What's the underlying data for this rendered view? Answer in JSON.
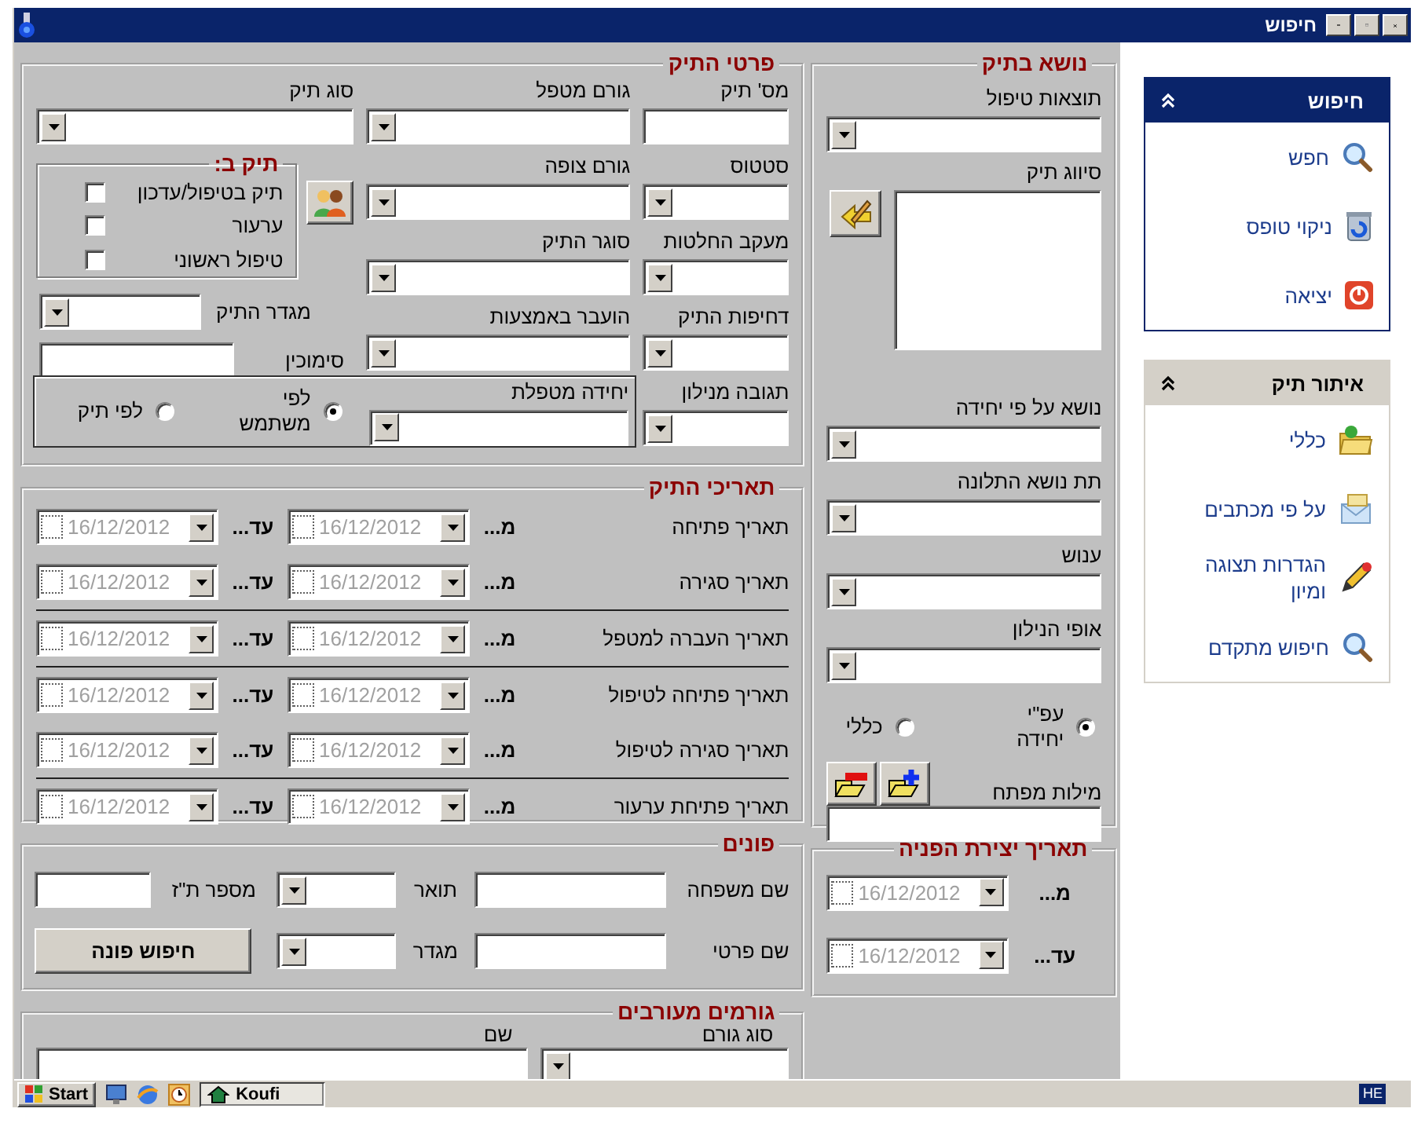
{
  "window": {
    "title": "חיפוש"
  },
  "case_details": {
    "title": "פרטי התיק",
    "fields": [
      {
        "label": "מס' תיק",
        "kind": "text"
      },
      {
        "label": "גורם מטפל",
        "kind": "combo"
      },
      {
        "label": "סוג תיק",
        "kind": "combo"
      },
      {
        "label": "סטטוס",
        "kind": "combo"
      },
      {
        "label": "גורם צופה",
        "kind": "combo"
      },
      {
        "label": "מעקב החלטות",
        "kind": "combo"
      },
      {
        "label": "סוגר התיק",
        "kind": "combo"
      },
      {
        "label": "דחיפות התיק",
        "kind": "combo"
      },
      {
        "label": "הועבר באמצעות",
        "kind": "combo"
      },
      {
        "label": "תגובה מנילון",
        "kind": "combo"
      },
      {
        "label": "מגדר התיק",
        "kind": "combo"
      },
      {
        "label": "סימוכין",
        "kind": "text"
      }
    ],
    "case_in": {
      "title": "תיק ב:",
      "options": [
        {
          "label": "תיק בטיפול/עדכון",
          "checked": false
        },
        {
          "label": "ערעור",
          "checked": false
        },
        {
          "label": "טיפול ראשוני",
          "checked": false
        }
      ]
    },
    "handling_unit": {
      "label": "יחידה מטפלת",
      "kind": "combo",
      "scope": [
        {
          "label": "לפי משתמש",
          "selected": true
        },
        {
          "label": "לפי תיק",
          "selected": false
        }
      ]
    }
  },
  "case_dates": {
    "title": "תאריכי התיק",
    "rows": [
      {
        "label": "תאריך פתיחה",
        "from_label": "מ...",
        "from": {
          "value": "16/12/2012",
          "checked": false
        },
        "to_label": "עד...",
        "to": {
          "value": "16/12/2012",
          "checked": false
        },
        "divider_after": false
      },
      {
        "label": "תאריך סגירה",
        "from_label": "מ...",
        "from": {
          "value": "16/12/2012",
          "checked": false
        },
        "to_label": "עד...",
        "to": {
          "value": "16/12/2012",
          "checked": false
        },
        "divider_after": true
      },
      {
        "label": "תאריך העברה למטפל",
        "from_label": "מ...",
        "from": {
          "value": "16/12/2012",
          "checked": false
        },
        "to_label": "עד...",
        "to": {
          "value": "16/12/2012",
          "checked": false
        },
        "divider_after": true
      },
      {
        "label": "תאריך פתיחה לטיפול",
        "from_label": "מ...",
        "from": {
          "value": "16/12/2012",
          "checked": false
        },
        "to_label": "עד...",
        "to": {
          "value": "16/12/2012",
          "checked": false
        },
        "divider_after": false
      },
      {
        "label": "תאריך סגירה לטיפול",
        "from_label": "מ...",
        "from": {
          "value": "16/12/2012",
          "checked": false
        },
        "to_label": "עד...",
        "to": {
          "value": "16/12/2012",
          "checked": false
        },
        "divider_after": true
      },
      {
        "label": "תאריך פתיחת ערעור",
        "from_label": "מ...",
        "from": {
          "value": "16/12/2012",
          "checked": false
        },
        "to_label": "עד...",
        "to": {
          "value": "16/12/2012",
          "checked": false
        },
        "divider_after": false
      }
    ]
  },
  "applicants": {
    "title": "פונים",
    "fields": [
      {
        "label": "שם משפחה",
        "kind": "text"
      },
      {
        "label": "תואר",
        "kind": "combo"
      },
      {
        "label": "מספר ת\"ז",
        "kind": "text"
      },
      {
        "label": "שם פרטי",
        "kind": "text"
      },
      {
        "label": "מגדר",
        "kind": "combo"
      }
    ],
    "button": "חיפוש פונה"
  },
  "involved": {
    "title": "גורמים מעורבים",
    "fields": [
      {
        "label": "סוג גורם",
        "kind": "combo"
      },
      {
        "label": "שם",
        "kind": "text"
      }
    ]
  },
  "subject": {
    "title": "נושא בתיק",
    "fields": [
      {
        "label": "תוצאות טיפול",
        "kind": "combo"
      },
      {
        "label": "סיווג תיק",
        "kind": "listbox"
      },
      {
        "label": "נושא על פי יחידה",
        "kind": "combo"
      },
      {
        "label": "תת נושא התלונה",
        "kind": "combo"
      },
      {
        "label": "ענוש",
        "kind": "combo"
      },
      {
        "label": "אופי הנילון",
        "kind": "combo"
      }
    ],
    "scope": [
      {
        "label": "עפ\"י יחידה",
        "selected": true
      },
      {
        "label": "כללי",
        "selected": false
      }
    ],
    "keywords": {
      "label": "מילות מפתח",
      "kind": "text"
    }
  },
  "referral_date": {
    "title": "תאריך יצירת הפניה",
    "rows": [
      {
        "label": "מ...",
        "date": {
          "value": "16/12/2012",
          "checked": false
        }
      },
      {
        "label": "עד...",
        "date": {
          "value": "16/12/2012",
          "checked": false
        }
      }
    ]
  },
  "panes": [
    {
      "title": "חיפוש",
      "kind": "primary",
      "expanded": true,
      "items": [
        {
          "label": "חפש"
        },
        {
          "label": "ניקוי טופס"
        },
        {
          "label": "יציאה"
        }
      ]
    },
    {
      "title": "איתור תיק",
      "kind": "secondary",
      "expanded": true,
      "items": [
        {
          "label": "כללי"
        },
        {
          "label": "על פי מכתבים"
        },
        {
          "label": "הגדרות תצוגה ומיון"
        },
        {
          "label": "חיפוש מתקדם"
        }
      ]
    }
  ],
  "taskbar": {
    "start": "Start",
    "tasks": [
      {
        "label": "Koufi",
        "selected": true
      }
    ],
    "language": "HE"
  }
}
